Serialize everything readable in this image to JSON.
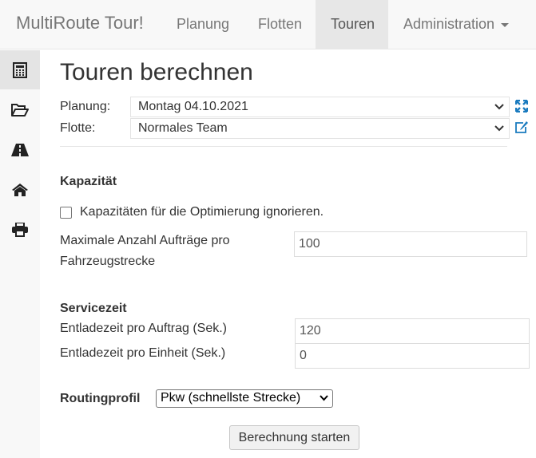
{
  "navbar": {
    "brand": "MultiRoute Tour!",
    "items": [
      {
        "label": "Planung"
      },
      {
        "label": "Flotten"
      },
      {
        "label": "Touren"
      },
      {
        "label": "Administration"
      }
    ]
  },
  "sidebar": {
    "items": [
      {
        "icon": "calculator-icon"
      },
      {
        "icon": "folder-open-icon"
      },
      {
        "icon": "road-icon"
      },
      {
        "icon": "home-icon"
      },
      {
        "icon": "print-icon"
      }
    ]
  },
  "page": {
    "title": "Touren berechnen",
    "planung_label": "Planung:",
    "planung_value": "Montag 04.10.2021",
    "flotte_label": "Flotte:",
    "flotte_value": "Normales Team"
  },
  "kapazitaet": {
    "heading": "Kapazität",
    "ignore_label": "Kapazitäten für die Optimierung ignorieren.",
    "max_label_line1": "Maximale Anzahl Aufträge pro",
    "max_label_line2": "Fahrzeugstrecke",
    "max_value": "100"
  },
  "servicezeit": {
    "heading": "Servicezeit",
    "auftrag_label": "Entladezeit pro Auftrag (Sek.)",
    "auftrag_value": "120",
    "einheit_label": "Entladezeit pro Einheit (Sek.)",
    "einheit_value": "0"
  },
  "routing": {
    "label": "Routingprofil",
    "value": "Pkw (schnellste Strecke)"
  },
  "actions": {
    "start_label": "Berechnung starten"
  },
  "colors": {
    "accent": "#1a7bbf",
    "navbar_bg": "#f8f8f8",
    "active_bg": "#e7e7e7"
  }
}
